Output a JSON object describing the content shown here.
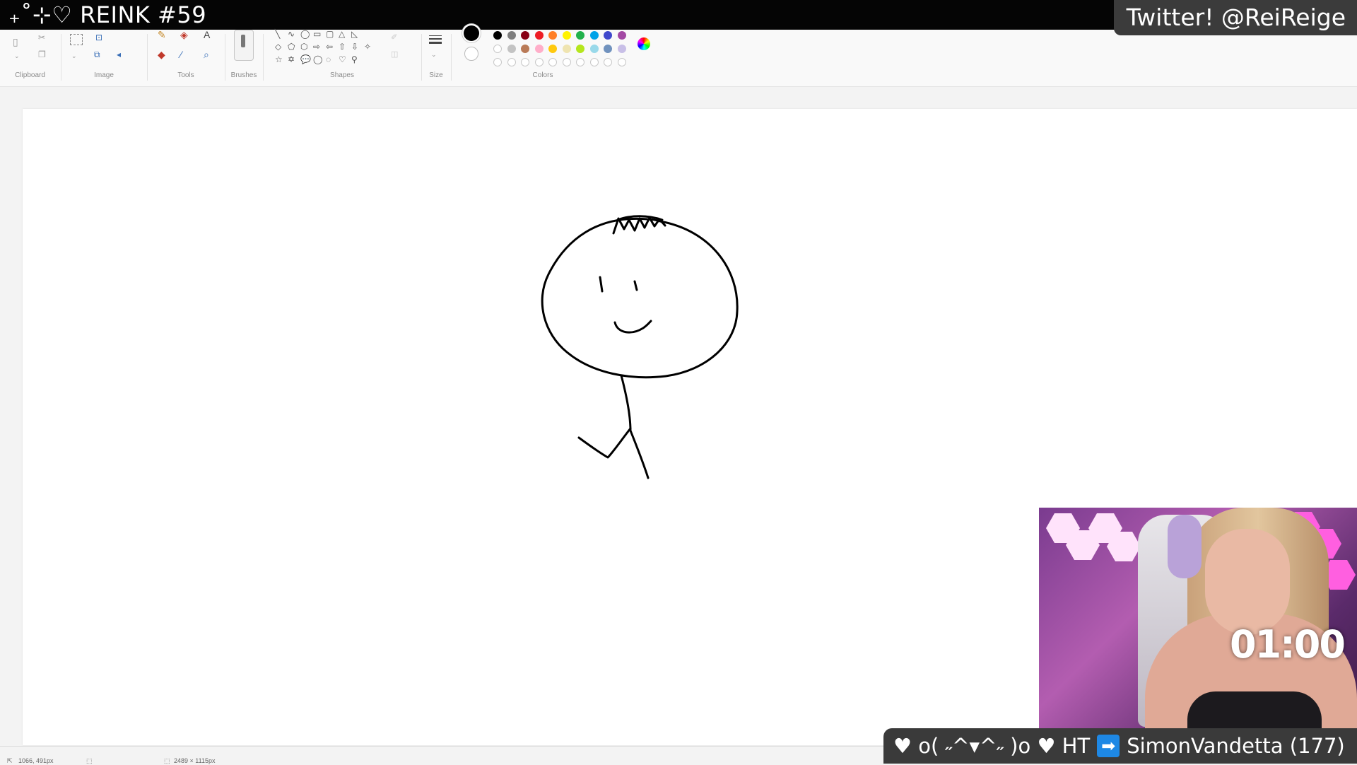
{
  "stream": {
    "title": "˚₊‧꒰ა ☆ ໒꒱ ‧₊˚ REINK #59",
    "title_short": "₊˚⊹♡ REINK #59",
    "twitter": "Twitter! @ReiReige",
    "timer": "01:00",
    "follow_message": "♥ o( ˶^▾^˶ )o ♥ HT",
    "follow_arrow": "➡",
    "follower_name": "SimonVandetta (177)"
  },
  "ribbon": {
    "groups": {
      "clipboard": "Clipboard",
      "image": "Image",
      "tools": "Tools",
      "brushes": "Brushes",
      "shapes": "Shapes",
      "size": "Size",
      "colors": "Colors"
    },
    "tool_text_icon": "A"
  },
  "palette": {
    "primary": "#000000",
    "secondary": "#ffffff",
    "row1": [
      "#000000",
      "#7f7f7f",
      "#880015",
      "#ed1c24",
      "#ff7f27",
      "#fff200",
      "#22b14c",
      "#00a2e8",
      "#3f48cc",
      "#a349a4"
    ],
    "row2": [
      "#ffffff",
      "#c3c3c3",
      "#b97a57",
      "#ffaec9",
      "#ffc90e",
      "#efe4b0",
      "#b5e61d",
      "#99d9ea",
      "#7092be",
      "#c8bfe7"
    ]
  },
  "status": {
    "cursor_position": "1066, 491px",
    "canvas_size": "2489 × 1115px"
  },
  "icons": [
    "paste-icon",
    "cut-icon",
    "copy-icon",
    "select-icon",
    "crop-icon",
    "resize-icon",
    "rotate-icon",
    "pencil-icon",
    "fill-icon",
    "text-icon",
    "eraser-icon",
    "color-picker-icon",
    "magnifier-icon",
    "brush-icon",
    "size-icon",
    "edit-colors-icon"
  ]
}
